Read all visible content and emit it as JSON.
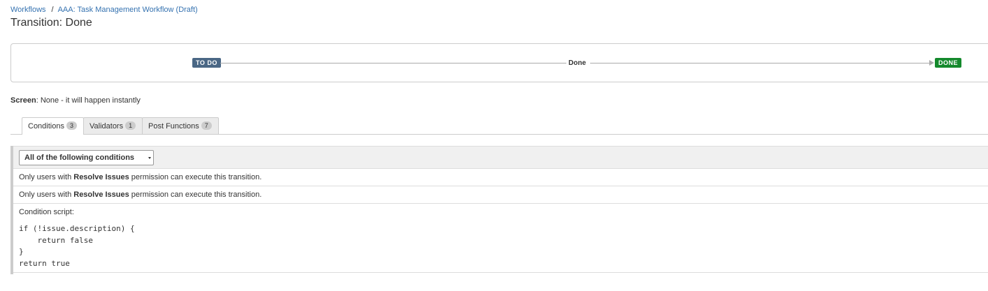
{
  "breadcrumb": {
    "root": "Workflows",
    "separator": "/",
    "current": "AAA: Task Management Workflow (Draft)"
  },
  "page_title": "Transition: Done",
  "diagram": {
    "from_status": "TO DO",
    "transition_name": "Done",
    "to_status": "DONE",
    "colors": {
      "todo": "#4a6785",
      "done": "#14892c"
    }
  },
  "screen": {
    "label": "Screen",
    "value": ": None - it will happen instantly"
  },
  "tabs": [
    {
      "label": "Conditions",
      "count": "3",
      "active": true
    },
    {
      "label": "Validators",
      "count": "1",
      "active": false
    },
    {
      "label": "Post Functions",
      "count": "7",
      "active": false
    }
  ],
  "conditions": {
    "mode_select": "All of the following conditions",
    "rows": [
      {
        "prefix": "Only users with ",
        "bold": "Resolve Issues",
        "suffix": " permission can execute this transition."
      },
      {
        "prefix": "Only users with ",
        "bold": "Resolve Issues",
        "suffix": " permission can execute this transition."
      }
    ],
    "script_label": "Condition script:",
    "script_code": "if (!issue.description) {\n    return false\n}\nreturn true"
  }
}
